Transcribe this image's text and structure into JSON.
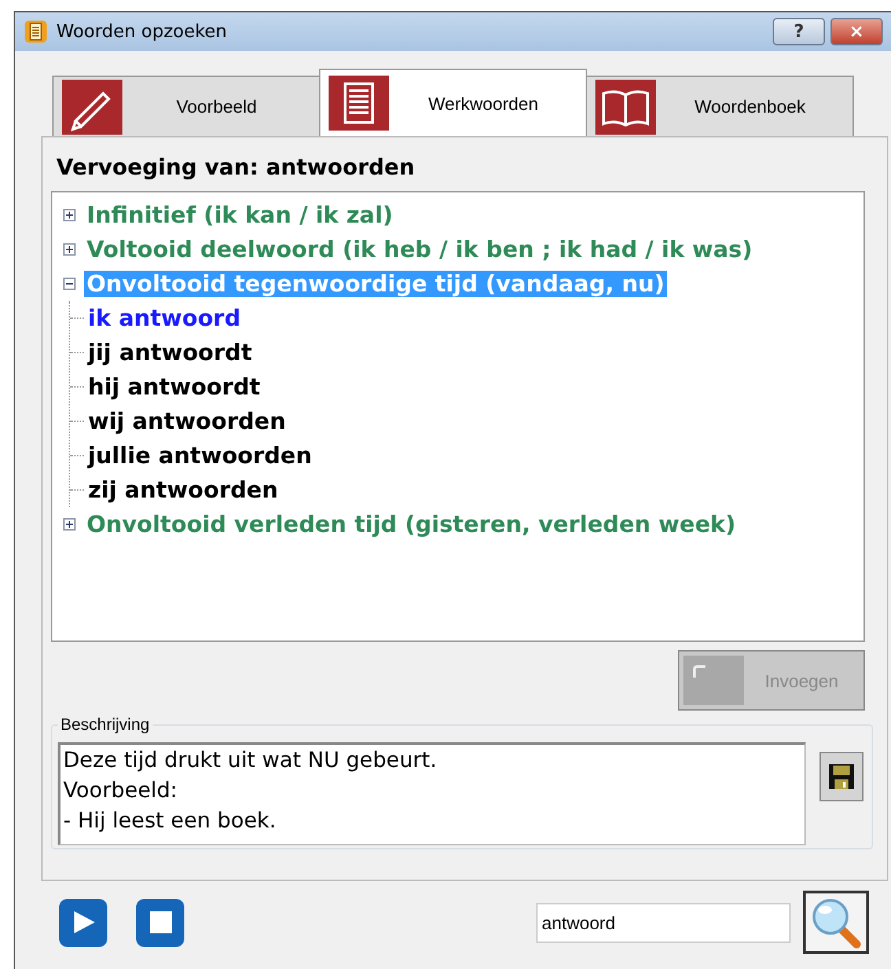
{
  "window": {
    "title": "Woorden opzoeken",
    "buttons": [
      "?",
      "×"
    ]
  },
  "tabs": [
    {
      "label": "Voorbeeld",
      "selected": false
    },
    {
      "label": "Werkwoorden",
      "selected": true
    },
    {
      "label": "Woordenboek",
      "selected": false
    }
  ],
  "heading": "Vervoeging van: antwoorden",
  "tree": [
    {
      "label": "Infinitief (ik kan / ik zal)",
      "expanded": false,
      "selected": false
    },
    {
      "label": "Voltooid deelwoord (ik heb / ik ben ; ik had / ik was)",
      "expanded": false,
      "selected": false
    },
    {
      "label": "Onvoltooid tegenwoordige tijd (vandaag, nu)",
      "expanded": true,
      "selected": true,
      "children": [
        {
          "label": "ik antwoord",
          "highlighted": true
        },
        {
          "label": "jij antwoordt",
          "highlighted": false
        },
        {
          "label": "hij antwoordt",
          "highlighted": false
        },
        {
          "label": "wij antwoorden",
          "highlighted": false
        },
        {
          "label": "jullie antwoorden",
          "highlighted": false
        },
        {
          "label": "zij antwoorden",
          "highlighted": false
        }
      ]
    },
    {
      "label": "Onvoltooid verleden tijd (gisteren, verleden week)",
      "expanded": false,
      "selected": false
    }
  ],
  "insert_button": {
    "label": "Invoegen",
    "disabled": true
  },
  "description": {
    "title": "Beschrijving",
    "lines": [
      "Deze tijd drukt uit wat NU gebeurt.",
      "Voorbeeld:",
      "- Hij leest een boek."
    ]
  },
  "search": {
    "value": "antwoord"
  }
}
